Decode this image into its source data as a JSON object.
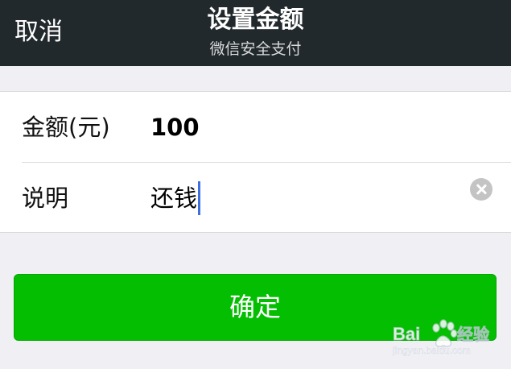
{
  "navbar": {
    "cancel_label": "取消",
    "title": "设置金额",
    "subtitle": "微信安全支付"
  },
  "form": {
    "amount_label": "金额(元)",
    "amount_value": "100",
    "note_label": "说明",
    "note_value": "还钱"
  },
  "confirm_label": "确定",
  "watermark": {
    "brand_a": "Bai",
    "brand_b": "经验",
    "url": "jingyan.baidu.com"
  },
  "colors": {
    "navbar_bg": "#22292c",
    "page_bg": "#efeff4",
    "confirm_green": "#04be02",
    "caret_blue": "#3d6fe0"
  },
  "icons": {
    "clear": "clear-circle-icon",
    "watermark_paw": "baidu-paw-icon"
  }
}
